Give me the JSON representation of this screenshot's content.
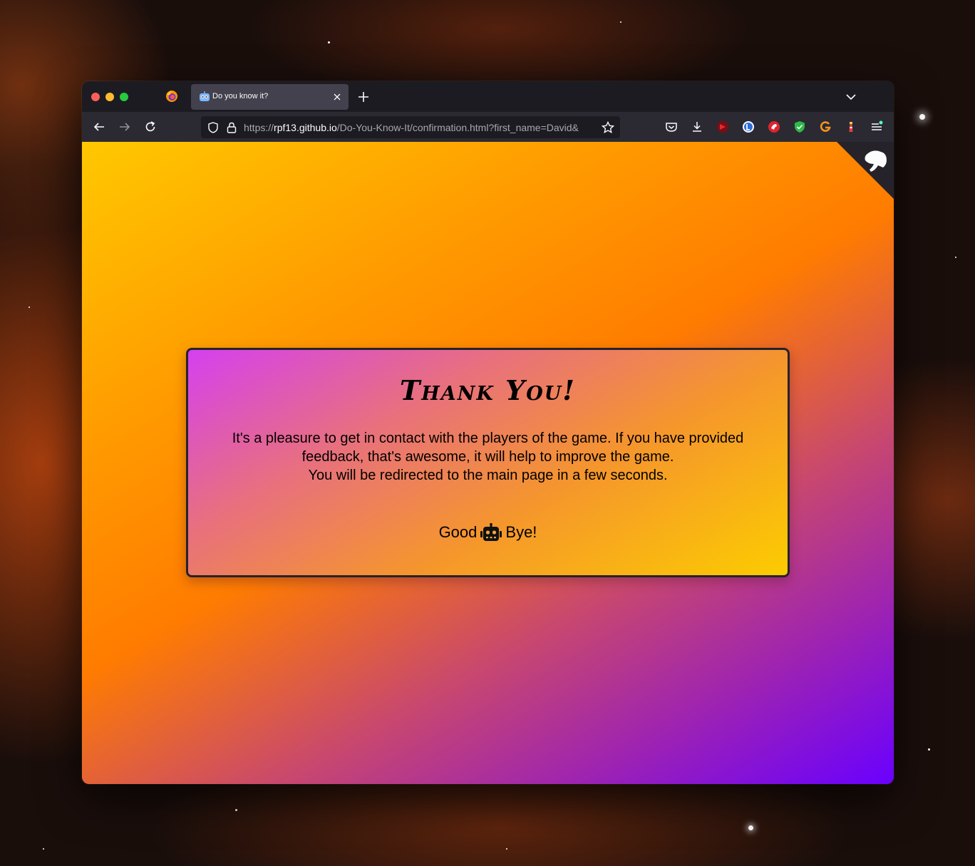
{
  "browser": {
    "tab": {
      "title": "Do you know it?",
      "favicon": "robot-icon"
    },
    "url": {
      "scheme": "https://",
      "host": "rpf13.github.io",
      "path": "/Do-You-Know-It/confirmation.html?first_name=David&"
    }
  },
  "page": {
    "corner_link": "github-octocat-icon",
    "card": {
      "title": "Thank You!",
      "lines": [
        "It's a pleasure to get in contact with the players of the game. If you have provided feedback, that's awesome, it will help to improve the game.",
        "You will be redirected to the main page in a few seconds."
      ],
      "bye_before": "Good",
      "bye_icon": "robot-icon",
      "bye_after": "Bye!"
    }
  },
  "colors": {
    "background_gradient": [
      "#ffc800",
      "#ff7c00",
      "#6a00ff"
    ],
    "card_gradient": [
      "#d540f0",
      "#fccc00"
    ],
    "card_border": "#26222a"
  }
}
